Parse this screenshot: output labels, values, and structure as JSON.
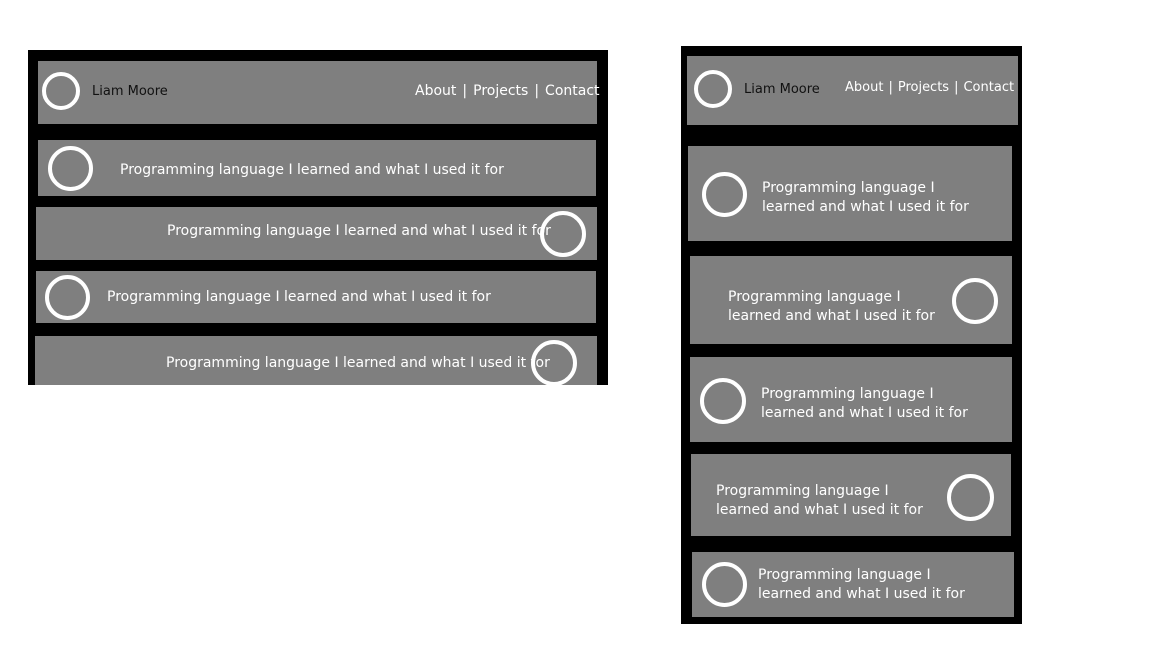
{
  "header": {
    "name": "Liam Moore",
    "nav": [
      "About",
      "Projects",
      "Contact"
    ],
    "separator": "|"
  },
  "cards": [
    "Programming language I learned and what I used it for",
    "Programming language I learned and what I used it for",
    "Programming language I learned and what I used it for",
    "Programming language I learned and what I used it for",
    "Programming language I learned and what I used it for"
  ],
  "colors": {
    "frame": "#000000",
    "panel": "#7f7f7f",
    "ring": "#ffffff",
    "text": "#ffffff"
  }
}
